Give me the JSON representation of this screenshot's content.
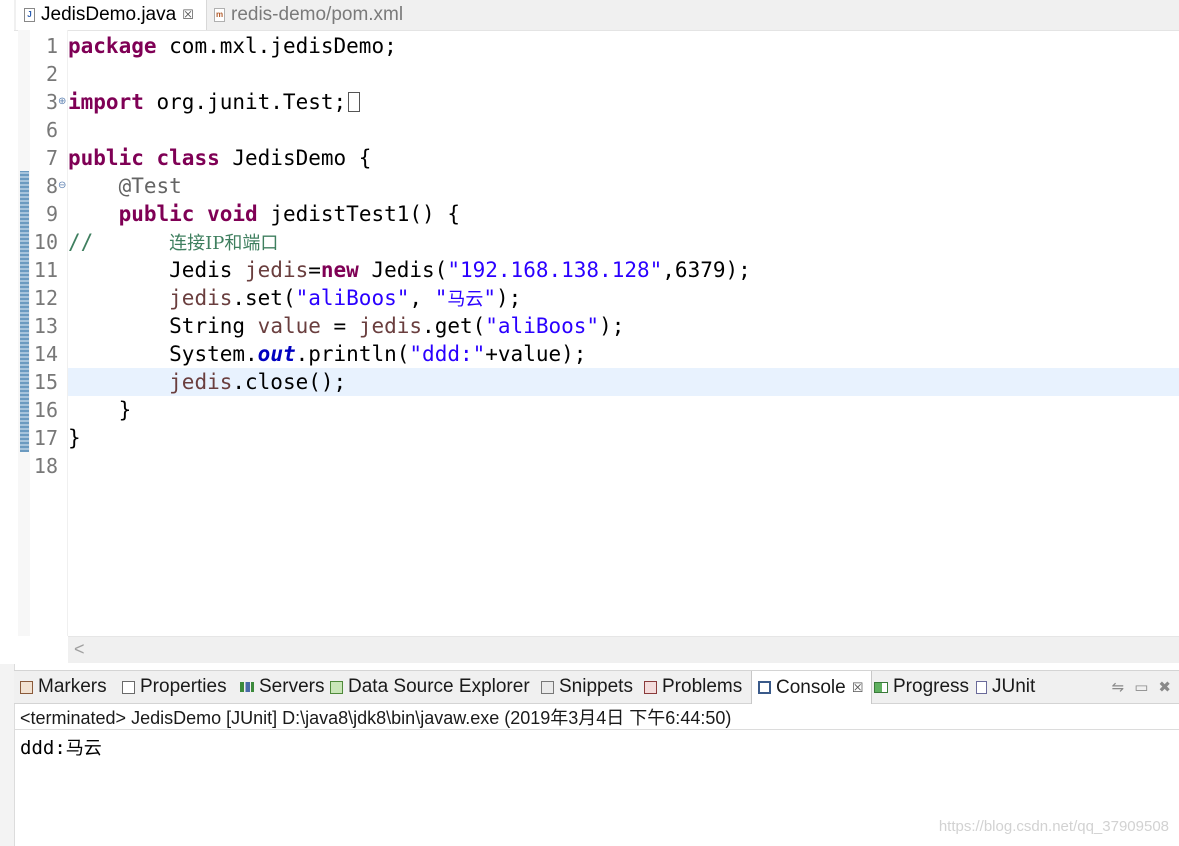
{
  "editor_tabs": [
    {
      "label": "JedisDemo.java",
      "active": true,
      "close": "☒"
    },
    {
      "label": "redis-demo/pom.xml",
      "active": false
    }
  ],
  "code_lines": [
    {
      "n": "1",
      "text": "package com.mxl.jedisDemo;"
    },
    {
      "n": "2",
      "text": ""
    },
    {
      "n": "3",
      "text": "import org.junit.Test;",
      "fold": "⊕"
    },
    {
      "n": "6",
      "text": ""
    },
    {
      "n": "7",
      "text": "public class JedisDemo {"
    },
    {
      "n": "8",
      "text": "    @Test",
      "fold": "⊖"
    },
    {
      "n": "9",
      "text": "    public void jedistTest1() {"
    },
    {
      "n": "10",
      "text": "//      连接IP和端口"
    },
    {
      "n": "11",
      "text": "        Jedis jedis=new Jedis(\"192.168.138.128\",6379);"
    },
    {
      "n": "12",
      "text": "        jedis.set(\"aliBoos\", \"马云\");"
    },
    {
      "n": "13",
      "text": "        String value = jedis.get(\"aliBoos\");"
    },
    {
      "n": "14",
      "text": "        System.out.println(\"ddd:\"+value);"
    },
    {
      "n": "15",
      "text": "        jedis.close();",
      "highlight": true
    },
    {
      "n": "16",
      "text": "    }"
    },
    {
      "n": "17",
      "text": "}"
    },
    {
      "n": "18",
      "text": ""
    }
  ],
  "code_tokens": {
    "l1_kw": "package",
    "l1_rest": " com.mxl.jedisDemo;",
    "l3_kw": "import",
    "l3_rest": " org.junit.Test;",
    "l7_kw1": "public",
    "l7_kw2": "class",
    "l7_rest": " JedisDemo {",
    "l8_ann": "@Test",
    "l9_kw1": "public",
    "l9_kw2": "void",
    "l9_rest": " jedistTest1() {",
    "l10_cmt": "//",
    "l10_cjk": "连接IP和端口",
    "l11_a": "Jedis ",
    "l11_var": "jedis",
    "l11_b": "=",
    "l11_kw": "new",
    "l11_c": " Jedis(",
    "l11_str": "\"192.168.138.128\"",
    "l11_d": ",6379);",
    "l12_var": "jedis",
    "l12_a": ".set(",
    "l12_str1": "\"aliBoos\"",
    "l12_b": ", ",
    "l12_q1": "\"",
    "l12_cjk": "马云",
    "l12_q2": "\"",
    "l12_c": ");",
    "l13_a": "String ",
    "l13_var1": "value",
    "l13_b": " = ",
    "l13_var2": "jedis",
    "l13_c": ".get(",
    "l13_str": "\"aliBoos\"",
    "l13_d": ");",
    "l14_a": "System.",
    "l14_fld": "out",
    "l14_b": ".println(",
    "l14_str": "\"ddd:\"",
    "l14_c": "+value);",
    "l15_var": "jedis",
    "l15_a": ".close();",
    "l16": "}",
    "l17": "}"
  },
  "view_tabs": [
    {
      "label": "Markers",
      "icon": "markers-icon"
    },
    {
      "label": "Properties",
      "icon": "properties-icon"
    },
    {
      "label": "Servers",
      "icon": "servers-icon"
    },
    {
      "label": "Data Source Explorer",
      "icon": "data-source-icon"
    },
    {
      "label": "Snippets",
      "icon": "snippets-icon"
    },
    {
      "label": "Problems",
      "icon": "problems-icon"
    },
    {
      "label": "Console",
      "icon": "console-icon",
      "active": true,
      "close": "☒"
    },
    {
      "label": "Progress",
      "icon": "progress-icon"
    },
    {
      "label": "JUnit",
      "icon": "junit-icon"
    }
  ],
  "view_tools": {
    "pin": "⇋",
    "minimize": "▭",
    "close": "✖"
  },
  "console": {
    "title": "<terminated> JedisDemo [JUnit] D:\\java8\\jdk8\\bin\\javaw.exe (2019年3月4日 下午6:44:50)",
    "output_prefix": "ddd:",
    "output_value": "马云"
  },
  "scroll_left_glyph": "<",
  "watermark": "https://blog.csdn.net/qq_37909508",
  "colors": {
    "keyword": "#7f0055",
    "string": "#2a00ff",
    "comment": "#3f7f5f",
    "variable": "#6a3e3e",
    "annotation": "#646464",
    "current_line": "#e8f2fe"
  }
}
